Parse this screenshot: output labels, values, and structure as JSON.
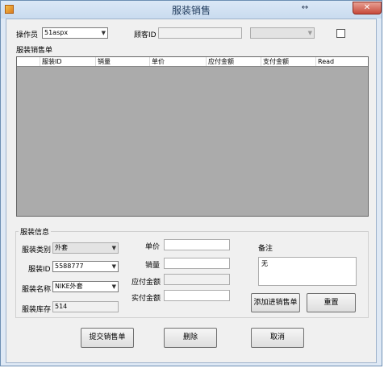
{
  "window": {
    "title": "服装销售",
    "resize_icon": "↔",
    "close_icon": "✕"
  },
  "top": {
    "operator_label": "操作员",
    "operator_value": "51aspx",
    "customer_id_label": "顾客ID",
    "customer_id_value": "",
    "customer_combo_value": ""
  },
  "sales_list": {
    "title": "服装销售单",
    "columns": [
      "服装ID",
      "销量",
      "单价",
      "应付金额",
      "支付金额",
      "Read"
    ]
  },
  "info": {
    "title": "服装信息",
    "category_label": "服装类别",
    "category_value": "外套",
    "clothes_id_label": "服装ID",
    "clothes_id_value": "5588777",
    "name_label": "服装名称",
    "name_value": "NIKE外套",
    "stock_label": "服装库存",
    "stock_value": "514",
    "price_label": "单价",
    "price_value": "",
    "quantity_label": "销量",
    "quantity_value": "",
    "payable_label": "应付金额",
    "payable_value": "",
    "paid_label": "实付金额",
    "paid_value": "",
    "remark_label": "备注",
    "remark_value": "无",
    "add_button": "添加进销售单",
    "reset_button": "重置"
  },
  "actions": {
    "submit": "提交销售单",
    "delete": "删除",
    "cancel": "取消"
  }
}
